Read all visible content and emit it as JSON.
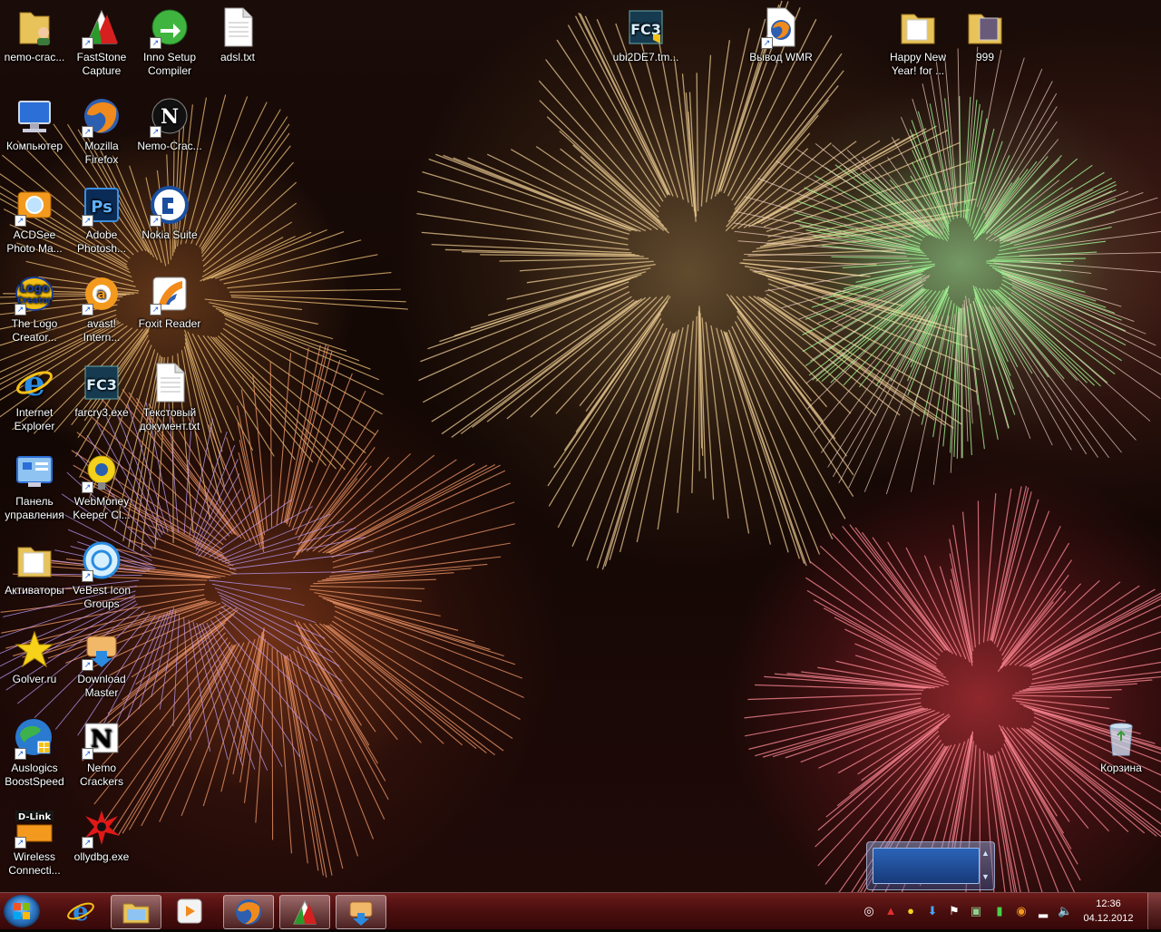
{
  "desktop": {
    "icons": [
      {
        "id": "nemo-crack-folder",
        "label": "nemo-crac...",
        "icon": "user-folder-icon"
      },
      {
        "id": "faststone",
        "label": "FastStone\nCapture",
        "icon": "faststone-icon"
      },
      {
        "id": "inno",
        "label": "Inno Setup\nCompiler",
        "icon": "inno-setup-icon"
      },
      {
        "id": "adsl",
        "label": "adsl.txt",
        "icon": "text-file-icon"
      },
      {
        "id": "computer",
        "label": "Компьютер",
        "icon": "computer-icon"
      },
      {
        "id": "firefox",
        "label": "Mozilla\nFirefox",
        "icon": "firefox-icon"
      },
      {
        "id": "nemo-crac2",
        "label": "Nemo-Crac...",
        "icon": "nemo-icon"
      },
      {
        "id": "acdsee",
        "label": "ACDSee\nPhoto Ma...",
        "icon": "acdsee-icon"
      },
      {
        "id": "photoshop",
        "label": "Adobe\nPhotosh...",
        "icon": "photoshop-icon"
      },
      {
        "id": "nokia",
        "label": "Nokia Suite",
        "icon": "nokia-suite-icon"
      },
      {
        "id": "logo-creator",
        "label": "The Logo\nCreator...",
        "icon": "logo-creator-icon"
      },
      {
        "id": "avast",
        "label": "avast!\nIntern...",
        "icon": "avast-icon"
      },
      {
        "id": "foxit",
        "label": "Foxit Reader",
        "icon": "foxit-reader-icon"
      },
      {
        "id": "ie",
        "label": "Internet\nExplorer",
        "icon": "internet-explorer-icon"
      },
      {
        "id": "farcry3",
        "label": "farcry3.exe",
        "icon": "farcry3-icon"
      },
      {
        "id": "textdoc",
        "label": "Текстовый\nдокумент.txt",
        "icon": "text-file-icon"
      },
      {
        "id": "control-panel",
        "label": "Панель\nуправления",
        "icon": "control-panel-icon"
      },
      {
        "id": "webmoney",
        "label": "WebMoney\nKeeper Cl...",
        "icon": "webmoney-icon"
      },
      {
        "id": "activators",
        "label": "Активаторы",
        "icon": "folder-icon"
      },
      {
        "id": "vebest",
        "label": "VeBest Icon\nGroups",
        "icon": "vebest-icon"
      },
      {
        "id": "golver",
        "label": "Golver.ru",
        "icon": "star-icon"
      },
      {
        "id": "download-master",
        "label": "Download\nMaster",
        "icon": "download-master-icon"
      },
      {
        "id": "auslogics",
        "label": "Auslogics\nBoostSpeed",
        "icon": "auslogics-icon"
      },
      {
        "id": "nemo-crackers",
        "label": "Nemo\nCrackers",
        "icon": "nemo-icon"
      },
      {
        "id": "dlink",
        "label": "Wireless\nConnecti...",
        "icon": "dlink-icon"
      },
      {
        "id": "ollydbg",
        "label": "ollydbg.exe",
        "icon": "ollydbg-icon"
      },
      {
        "id": "ubi",
        "label": "ubi2DE7.tm...",
        "icon": "farcry3-icon"
      },
      {
        "id": "wmr",
        "label": "Вывод WMR",
        "icon": "firefox-file-icon"
      },
      {
        "id": "happy-new-year",
        "label": "Happy New\nYear! for ...",
        "icon": "folder-icon"
      },
      {
        "id": "folder-999",
        "label": "999",
        "icon": "folder-icon"
      },
      {
        "id": "recycle-bin",
        "label": "Корзина",
        "icon": "recycle-bin-icon"
      }
    ]
  },
  "taskbar": {
    "start_icon": "windows-start-icon",
    "pinned": [
      {
        "id": "ie",
        "icon": "internet-explorer-icon"
      },
      {
        "id": "explorer",
        "icon": "explorer-folder-icon"
      },
      {
        "id": "media-player",
        "icon": "media-player-icon"
      },
      {
        "id": "firefox",
        "icon": "firefox-icon"
      },
      {
        "id": "faststone",
        "icon": "faststone-icon"
      },
      {
        "id": "download-master",
        "icon": "download-master-icon"
      }
    ],
    "tray_icons": [
      "nokia-suite-icon",
      "faststone-icon",
      "webmoney-icon",
      "download-icon",
      "action-center-flag-icon",
      "network-icon",
      "signal-icon",
      "avast-icon",
      "wireless-signal-icon",
      "volume-icon"
    ],
    "clock": {
      "time": "12:36",
      "date": "04.12.2012"
    }
  },
  "colors": {
    "taskbar": "#5a0c0c",
    "accent": "#2f78c6"
  }
}
